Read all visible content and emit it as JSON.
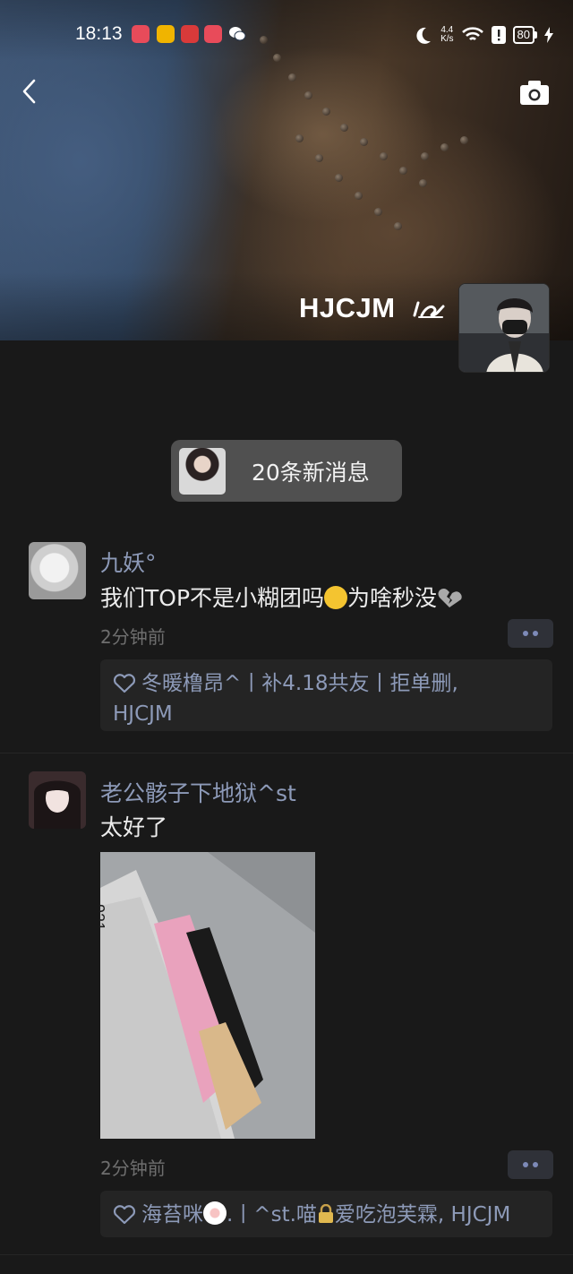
{
  "status_bar": {
    "time": "18:13",
    "net_speed_value": "4.4",
    "net_speed_unit": "K/s",
    "battery": "80"
  },
  "header": {
    "owner_name": "HJCJM"
  },
  "new_messages": {
    "label": "20条新消息"
  },
  "posts": [
    {
      "username": "九妖°",
      "text_before": "我们TOP不是小糊团吗",
      "text_mid": "为啥秒没",
      "time": "2分钟前",
      "likes_line1": "冬暖橹昂^丨补4.18共友丨拒单删,",
      "likes_line2": "HJCJM"
    },
    {
      "username": "老公骸子下地狱^st",
      "text": "太好了",
      "photo_label": "921",
      "time": "2分钟前",
      "likes_a": "海苔咪",
      "likes_b": ".丨^st.喵",
      "likes_c": "爱吃泡芙霖, HJCJM"
    }
  ],
  "colors": {
    "background": "#191919",
    "link_blue": "#8d9ab8",
    "pill": "#505050"
  }
}
